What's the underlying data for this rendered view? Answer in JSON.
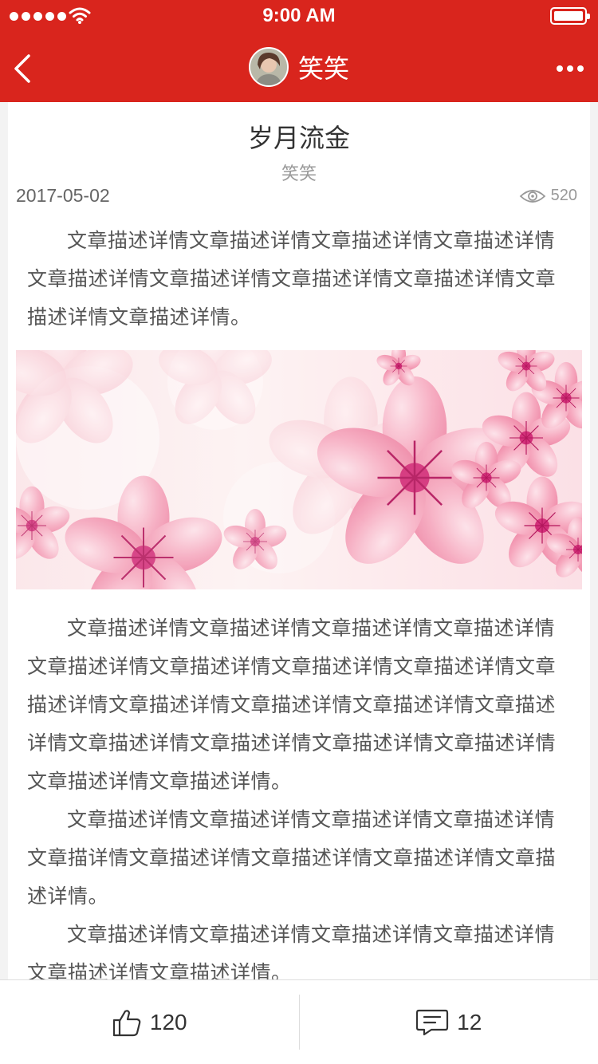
{
  "status_bar": {
    "time": "9:00 AM"
  },
  "nav": {
    "title": "笑笑",
    "back_icon": "chevron-left-icon",
    "more_icon": "more-dots-icon"
  },
  "article": {
    "title": "岁月流金",
    "author": "笑笑",
    "date": "2017-05-02",
    "views": "520",
    "paragraphs": [
      "文章描述详情文章描述详情文章描述详情文章描述详情文章描述详情文章描述详情文章描述详情文章描述详情文章描述详情文章描述详情。",
      "文章描述详情文章描述详情文章描述详情文章描述详情文章描述详情文章描述详情文章描述详情文章描述详情文章描述详情文章描述详情文章描述详情文章描述详情文章描述详情文章描述详情文章描述详情文章描述详情文章描述详情文章描述详情文章描述详情。",
      "文章描述详情文章描述详情文章描述详情文章描述详情文章描详情文章描述详情文章描述详情文章描述详情文章描述详情。",
      "文章描述详情文章描述详情文章描述详情文章描述详情文章描述详情文章描述详情。"
    ]
  },
  "bottom_bar": {
    "like_count": "120",
    "comment_count": "12"
  },
  "colors": {
    "primary": "#d9251d"
  }
}
